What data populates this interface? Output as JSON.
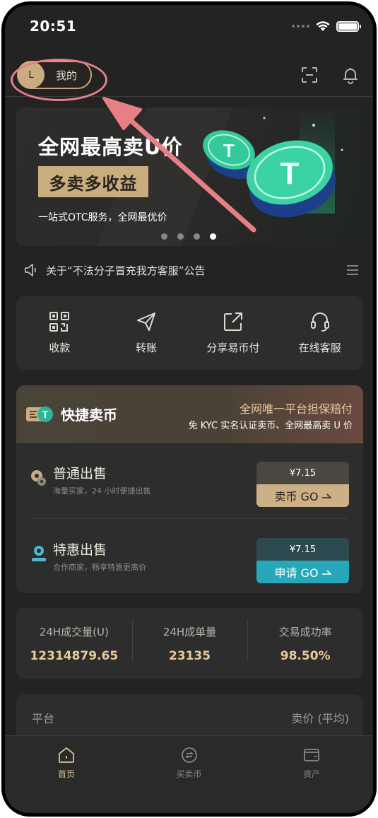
{
  "status_bar": {
    "time": "20:51"
  },
  "header": {
    "avatar_initial": "L",
    "mine_label": "我的"
  },
  "banner": {
    "title": "全网最高卖U价",
    "tag": "多卖多收益",
    "subtitle": "一站式OTC服务，全网最优价",
    "page_count": 4,
    "active_page": 4
  },
  "notice": {
    "text": "关于“不法分子冒充我方客服”公告"
  },
  "quick_actions": [
    {
      "label": "收款",
      "icon": "qr-code-icon"
    },
    {
      "label": "转账",
      "icon": "paper-plane-icon"
    },
    {
      "label": "分享易币付",
      "icon": "share-icon"
    },
    {
      "label": "在线客服",
      "icon": "headset-icon"
    }
  ],
  "sell": {
    "title": "快捷卖币",
    "slogan": "全网唯一平台担保赔付",
    "slogan2": "免 KYC 实名认证卖币、全网最高卖 U 价",
    "offers": [
      {
        "title": "普通出售",
        "subtitle": "海量买家，24 小时便捷出售",
        "price": "¥7.15",
        "button": "卖币 GO"
      },
      {
        "title": "特惠出售",
        "subtitle": "合作商家，畅享特惠更高价",
        "price": "¥7.15",
        "button": "申请 GO"
      }
    ]
  },
  "stats": [
    {
      "label": "24H成交量(U)",
      "value": "12314879.65"
    },
    {
      "label": "24H成单量",
      "value": "23135"
    },
    {
      "label": "交易成功率",
      "value": "98.50%"
    }
  ],
  "platform": {
    "left": "平台",
    "right": "卖价 (平均)"
  },
  "tabs": [
    {
      "label": "首页",
      "icon": "home-icon",
      "active": true
    },
    {
      "label": "买卖币",
      "icon": "exchange-icon",
      "active": false
    },
    {
      "label": "资产",
      "icon": "wallet-icon",
      "active": false
    }
  ],
  "colors": {
    "accent_gold": "#c9ad7f",
    "accent_teal": "#26a8b8",
    "annotation_pink": "#e87f87",
    "background": "#232323"
  }
}
